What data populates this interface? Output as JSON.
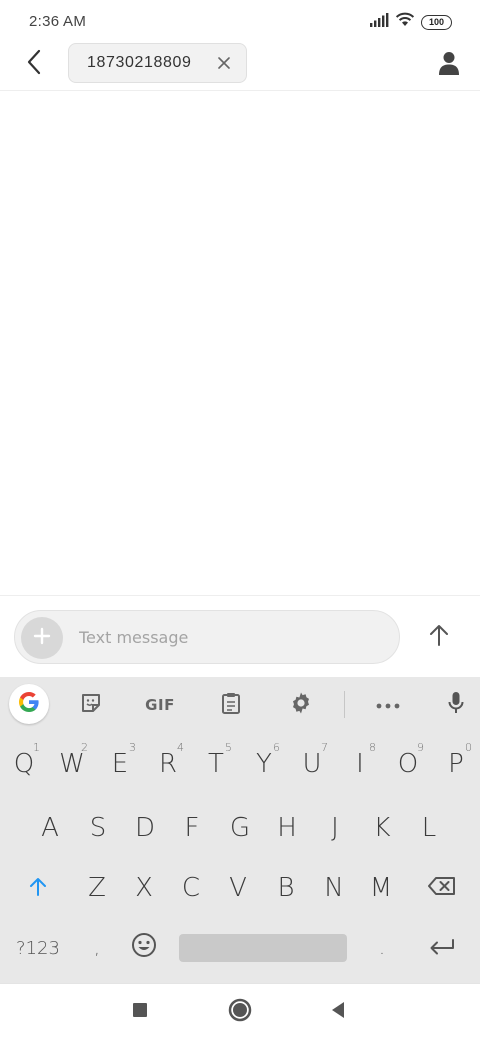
{
  "status_bar": {
    "time": "2:36 AM",
    "battery": "100",
    "icons": [
      "signal-icon",
      "wifi-icon",
      "battery-icon"
    ]
  },
  "header": {
    "recipient": "18730218809"
  },
  "composer": {
    "placeholder": "Text message"
  },
  "keyboard": {
    "toolbar": {
      "gif_label": "GIF",
      "icons": [
        "google-icon",
        "sticker-icon",
        "gif-icon",
        "clipboard-icon",
        "settings-icon",
        "more-icon",
        "microphone-icon"
      ]
    },
    "row1": [
      {
        "key": "Q",
        "hint": "1"
      },
      {
        "key": "W",
        "hint": "2"
      },
      {
        "key": "E",
        "hint": "3"
      },
      {
        "key": "R",
        "hint": "4"
      },
      {
        "key": "T",
        "hint": "5"
      },
      {
        "key": "Y",
        "hint": "6"
      },
      {
        "key": "U",
        "hint": "7"
      },
      {
        "key": "I",
        "hint": "8"
      },
      {
        "key": "O",
        "hint": "9"
      },
      {
        "key": "P",
        "hint": "0"
      }
    ],
    "row2": [
      "A",
      "S",
      "D",
      "F",
      "G",
      "H",
      "J",
      "K",
      "L"
    ],
    "row3": [
      "Z",
      "X",
      "C",
      "V",
      "B",
      "N",
      "M"
    ],
    "row4": {
      "symbols": "?123",
      "comma": ",",
      "period": "."
    }
  },
  "colors": {
    "accent_shift": "#2196f3",
    "keyboard_bg": "#e8e8e8",
    "chip_bg": "#f2f2f2"
  }
}
